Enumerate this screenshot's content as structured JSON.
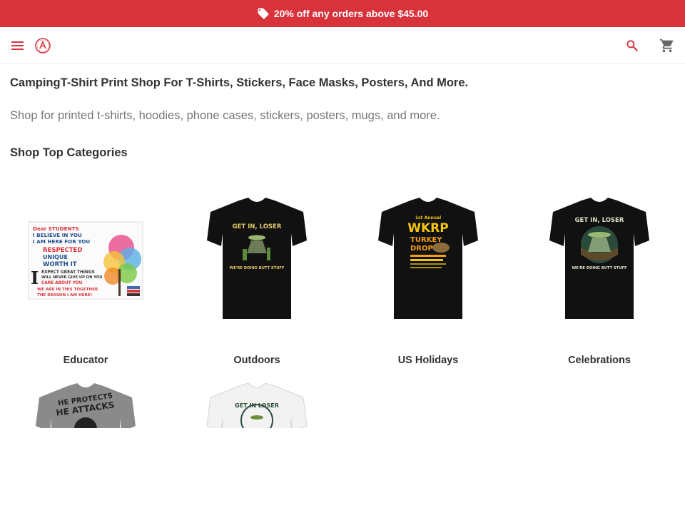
{
  "promo": {
    "text": "20% off any orders above $45.00",
    "icon": "tag-icon",
    "bg_color": "#d8323b"
  },
  "nav": {
    "menu_icon": "menu-icon",
    "logo_icon": "logo-icon",
    "search_icon": "search-icon",
    "cart_icon": "cart-icon",
    "accent_color": "#d8323b"
  },
  "page": {
    "title": "CampingT-Shirt Print Shop For T-Shirts, Stickers, Face Masks, Posters, And More.",
    "subtitle": "Shop for printed t-shirts, hoodies, phone cases, stickers, posters, mugs, and more.",
    "section_title": "Shop Top Categories"
  },
  "categories": [
    {
      "label": "Educator",
      "image_text": [
        "Dear STUDENTS",
        "I BELIEVE IN YOU",
        "I AM HERE FOR YOU",
        "RESPECTED",
        "UNIQUE",
        "WORTH IT",
        "EXPECT GREAT THINGS",
        "WILL NEVER GIVE UP ON YOU",
        "CARE ABOUT YOU",
        "WE ARE IN THIS TOGETHER",
        "THE REASON I AM HERE!"
      ]
    },
    {
      "label": "Outdoors",
      "image_text": [
        "GET IN, LOSER",
        "WE'RE DOING BUTT STUFF"
      ]
    },
    {
      "label": "US Holidays",
      "image_text": [
        "1st Annual",
        "WKRP",
        "TURKEY",
        "DROP"
      ]
    },
    {
      "label": "Celebrations",
      "image_text": [
        "GET IN, LOSER",
        "WE'RE DOING BUTT STUFF"
      ]
    },
    {
      "label": "",
      "image_text": [
        "HE PROTECTS",
        "HE ATTACKS"
      ]
    },
    {
      "label": "",
      "image_text": [
        "GET IN LOSER"
      ]
    }
  ]
}
